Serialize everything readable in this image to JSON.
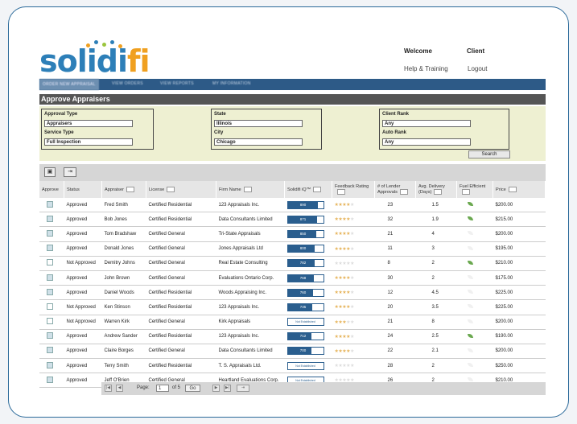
{
  "header": {
    "logo_text": "solidi",
    "logo_accent": "fi",
    "welcome": "Welcome",
    "client": "Client",
    "help": "Help & Training",
    "logout": "Logout"
  },
  "nav": {
    "tabs": [
      "ORDER NEW APPRAISAL",
      "VIEW ORDERS",
      "VIEW REPORTS",
      "MY INFORMATION"
    ]
  },
  "page_title": "Approve Appraisers",
  "filters": {
    "approval_type_label": "Approval Type",
    "approval_type_value": "Appraisers",
    "service_type_label": "Service Type",
    "service_type_value": "Full Inspection",
    "state_label": "State",
    "state_value": "Illinois",
    "city_label": "City",
    "city_value": "Chicago",
    "client_rank_label": "Client Rank",
    "client_rank_value": "Any",
    "auto_rank_label": "Auto Rank",
    "auto_rank_value": "Any",
    "search_label": "Search"
  },
  "columns": {
    "approve": "Approve",
    "status": "Status",
    "appraiser": "Appraiser",
    "license": "License",
    "firm": "Firm Name",
    "iq": "Solidifi iQ™",
    "feedback": "Feedback Rating",
    "lender": "# of Lender Approvals",
    "delivery": "Avg. Delivery (Days)",
    "fuel": "Fuel Efficient",
    "price": "Price"
  },
  "rows": [
    {
      "approved": true,
      "status": "Approved",
      "appraiser": "Fred Smith",
      "license": "Certified Residential",
      "firm": "123 Appraisals Inc.",
      "iq": "890",
      "iq_level": 0.85,
      "stars": 4,
      "lender": "23",
      "delivery": "1.5",
      "fuel": true,
      "price": "$200.00"
    },
    {
      "approved": true,
      "status": "Approved",
      "appraiser": "Bob Jones",
      "license": "Certified Residential",
      "firm": "Data Consultants Limited",
      "iq": "871",
      "iq_level": 0.82,
      "stars": 4,
      "lender": "32",
      "delivery": "1.9",
      "fuel": true,
      "price": "$215.00"
    },
    {
      "approved": true,
      "status": "Approved",
      "appraiser": "Tom Bradshaw",
      "license": "Certified General",
      "firm": "Tri-State Appraisals",
      "iq": "850",
      "iq_level": 0.8,
      "stars": 4,
      "lender": "21",
      "delivery": "4",
      "fuel": false,
      "price": "$200.00"
    },
    {
      "approved": true,
      "status": "Approved",
      "appraiser": "Donald Jones",
      "license": "Certified General",
      "firm": "Jones Appraisals Ltd",
      "iq": "800",
      "iq_level": 0.77,
      "stars": 4,
      "lender": "11",
      "delivery": "3",
      "fuel": false,
      "price": "$195.00"
    },
    {
      "approved": false,
      "status": "Not Approved",
      "appraiser": "Demitry Johns",
      "license": "Certified General",
      "firm": "Real Estate Consulting",
      "iq": "782",
      "iq_level": 0.75,
      "stars": 0,
      "lender": "8",
      "delivery": "2",
      "fuel": true,
      "price": "$210.00"
    },
    {
      "approved": true,
      "status": "Approved",
      "appraiser": "John Brown",
      "license": "Certified General",
      "firm": "Evaluations Ontario Corp.",
      "iq": "768",
      "iq_level": 0.73,
      "stars": 4,
      "lender": "30",
      "delivery": "2",
      "fuel": false,
      "price": "$175.00"
    },
    {
      "approved": true,
      "status": "Approved",
      "appraiser": "Daniel Woods",
      "license": "Certified Residential",
      "firm": "Woods Appraising Inc.",
      "iq": "760",
      "iq_level": 0.72,
      "stars": 4,
      "lender": "12",
      "delivery": "4.5",
      "fuel": false,
      "price": "$225.00"
    },
    {
      "approved": false,
      "status": "Not Approved",
      "appraiser": "Ken Stinson",
      "license": "Certified Residential",
      "firm": "123 Appraisals Inc.",
      "iq": "735",
      "iq_level": 0.7,
      "stars": 4,
      "lender": "20",
      "delivery": "3.5",
      "fuel": false,
      "price": "$225.00"
    },
    {
      "approved": false,
      "status": "Not Approved",
      "appraiser": "Warren Kirk",
      "license": "Certified General",
      "firm": "Kirk Appraisals",
      "iq": "Not Established",
      "iq_level": 0,
      "stars": 3,
      "lender": "21",
      "delivery": "8",
      "fuel": false,
      "price": "$200.00"
    },
    {
      "approved": true,
      "status": "Approved",
      "appraiser": "Andrew Sander",
      "license": "Certified Residential",
      "firm": "123 Appraisals Inc.",
      "iq": "712",
      "iq_level": 0.68,
      "stars": 4,
      "lender": "24",
      "delivery": "2.5",
      "fuel": true,
      "price": "$190.00"
    },
    {
      "approved": true,
      "status": "Approved",
      "appraiser": "Claire Borges",
      "license": "Certified General",
      "firm": "Data Consultants Limited",
      "iq": "700",
      "iq_level": 0.66,
      "stars": 4,
      "lender": "22",
      "delivery": "2.1",
      "fuel": false,
      "price": "$200.00"
    },
    {
      "approved": true,
      "status": "Approved",
      "appraiser": "Terry Smith",
      "license": "Certified Residential",
      "firm": "T. S. Appraisals Ltd.",
      "iq": "Not Established",
      "iq_level": 0,
      "stars": 0,
      "lender": "28",
      "delivery": "2",
      "fuel": false,
      "price": "$250.00"
    },
    {
      "approved": true,
      "status": "Approved",
      "appraiser": "Jeff O'Brien",
      "license": "Certified General",
      "firm": "Heartland Evaluations Corp.",
      "iq": "Not Established",
      "iq_level": 0,
      "stars": 0,
      "lender": "26",
      "delivery": "2",
      "fuel": false,
      "price": "$210.00"
    }
  ],
  "pager": {
    "page_label": "Page:",
    "page_value": "1",
    "of_label": "of 5",
    "go_label": "Go"
  },
  "colors": {
    "primary": "#2d5a87",
    "accent": "#f0a020",
    "filter_bg": "#eef0d2"
  }
}
